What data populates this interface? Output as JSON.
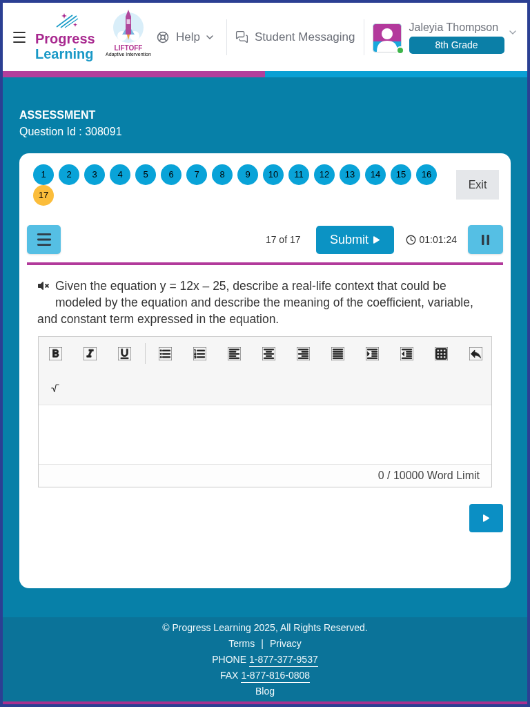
{
  "header": {
    "logo": {
      "line_1": "Progress",
      "line_2": "Learning"
    },
    "liftoff": {
      "title": "LIFTOFF",
      "subtitle": "Adaptive Intervention"
    },
    "help": "Help",
    "messaging": "Student Messaging",
    "user": {
      "name": "Jaleyia Thompson",
      "grade": "8th Grade",
      "online": true
    }
  },
  "assessment": {
    "heading": "ASSESSMENT",
    "question_id": "Question Id : 308091"
  },
  "questions": [
    {
      "label": "1",
      "selected": false
    },
    {
      "label": "2",
      "selected": false
    },
    {
      "label": "3",
      "selected": false
    },
    {
      "label": "4",
      "selected": false
    },
    {
      "label": "5",
      "selected": false
    },
    {
      "label": "6",
      "selected": false
    },
    {
      "label": "7",
      "selected": false
    },
    {
      "label": "8",
      "selected": false
    },
    {
      "label": "9",
      "selected": false
    },
    {
      "label": "10",
      "selected": false
    },
    {
      "label": "11",
      "selected": false
    },
    {
      "label": "12",
      "selected": false
    },
    {
      "label": "13",
      "selected": false
    },
    {
      "label": "14",
      "selected": false
    },
    {
      "label": "15",
      "selected": false
    },
    {
      "label": "16",
      "selected": false
    },
    {
      "label": "17",
      "selected": true
    }
  ],
  "exit": "Exit",
  "toolbar": {
    "position": "17 of 17",
    "submit": "Submit",
    "timer": "01:01:24"
  },
  "question": {
    "muted": true,
    "text": "Given the equation y = 12x – 25, describe a real-life context that could be modeled by the equation and describe the meaning of the coefficient, variable, and constant term expressed in the equation."
  },
  "editor": {
    "word_count": "0 / 10000 Word Limit"
  },
  "footer": {
    "copyright": "© Progress Learning 2025, All Rights Reserved.",
    "links": [
      "Terms",
      "Privacy"
    ],
    "separator": "|",
    "phone_label": "PHONE",
    "phone": "1-877-377-9537",
    "fax_label": "FAX",
    "fax": "1-877-816-0808",
    "blog": "Blog"
  }
}
